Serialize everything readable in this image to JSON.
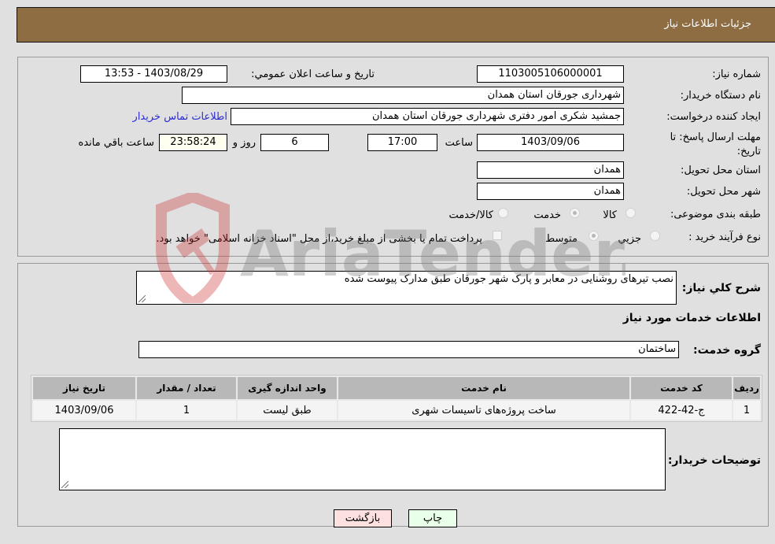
{
  "header": {
    "title": "جزئیات اطلاعات نیاز"
  },
  "form": {
    "need_number": {
      "label": "شماره نیاز:",
      "value": "1103005106000001"
    },
    "announce_datetime": {
      "label": "تاریخ و ساعت اعلان عمومي:",
      "value": "1403/08/29 - 13:53"
    },
    "buyer_org": {
      "label": "نام دستگاه خریدار:",
      "value": "شهرداری جورقان استان همدان"
    },
    "requester": {
      "label": "ایجاد کننده درخواست:",
      "value": "جمشید  شکری امور دفتری شهرداری جورقان استان همدان"
    },
    "buyer_contact_link": "اطلاعات تماس خریدار",
    "deadline": {
      "label": "مهلت ارسال پاسخ: تا تاریخ:",
      "date": "1403/09/06",
      "time_label": "ساعت",
      "time": "17:00",
      "days": "6",
      "days_label": "روز و",
      "remaining": "23:58:24",
      "remaining_label": "ساعت باقي مانده"
    },
    "delivery_province": {
      "label": "استان محل تحویل:",
      "value": "همدان"
    },
    "delivery_city": {
      "label": "شهر محل تحویل:",
      "value": "همدان"
    },
    "category": {
      "label": "طبقه بندی موضوعی:",
      "options": [
        "کالا",
        "خدمت",
        "کالا/خدمت"
      ],
      "selected": "خدمت"
    },
    "purchase_type": {
      "label": "نوع فرآیند خرید :",
      "options": [
        "جزيي",
        "متوسط"
      ],
      "selected": "متوسط",
      "treasury_note": "پرداخت تمام یا بخشی از مبلغ خرید،از محل \"اسناد خزانه اسلامی\" خواهد بود."
    }
  },
  "description": {
    "label": "شرح کلي نیاز:",
    "value": "نصب تیرهای روشنایی در معابر و پارک شهر جورقان طبق مدارک پیوست شده"
  },
  "services_section": {
    "title": "اطلاعات خدمات مورد نیاز",
    "group_label": "گروه خدمت:",
    "group_value": "ساختمان",
    "table": {
      "headers": [
        "ردیف",
        "کد خدمت",
        "نام خدمت",
        "واحد اندازه گیری",
        "تعداد / مقدار",
        "تاریخ نیاز"
      ],
      "rows": [
        [
          "1",
          "ج-42-422",
          "ساخت پروژه‌های تاسیسات شهری",
          "طبق لیست",
          "1",
          "1403/09/06"
        ]
      ]
    }
  },
  "buyer_notes": {
    "label": "توضیحات خریدار:",
    "value": ""
  },
  "buttons": {
    "back": "بازگشت",
    "print": "چاپ"
  },
  "watermark": {
    "text": "AriaTender.neT",
    "accent": "#d9a0a0"
  }
}
